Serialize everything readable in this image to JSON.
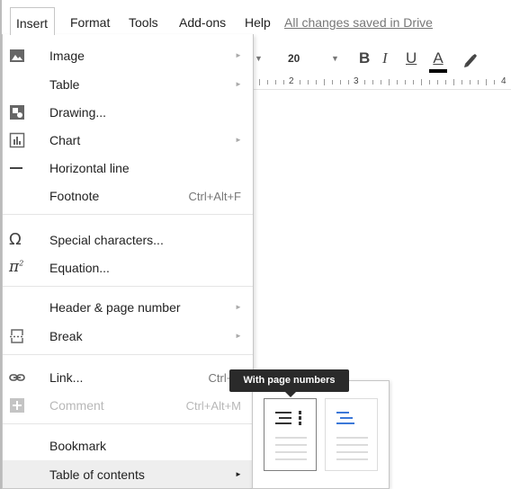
{
  "menubar": {
    "items": [
      "Insert",
      "Format",
      "Tools",
      "Add-ons",
      "Help"
    ],
    "save_status": "All changes saved in Drive"
  },
  "toolbar": {
    "font_size": "20",
    "bold_label": "B",
    "italic_label": "I",
    "underline_label": "U",
    "text_color_label": "A",
    "text_color_bar": "#000000"
  },
  "ruler": {
    "numbers": [
      "2",
      "3",
      "4"
    ]
  },
  "insert_menu": {
    "items": [
      {
        "label": "Image",
        "icon": "image-icon",
        "submenu": true
      },
      {
        "label": "Table",
        "submenu": true
      },
      {
        "label": "Drawing...",
        "icon": "drawing-icon"
      },
      {
        "label": "Chart",
        "icon": "chart-icon",
        "submenu": true
      },
      {
        "label": "Horizontal line",
        "icon": "horizontal-line-icon"
      },
      {
        "label": "Footnote",
        "shortcut": "Ctrl+Alt+F"
      },
      {
        "label": "Special characters...",
        "icon": "omega-icon"
      },
      {
        "label": "Equation...",
        "icon": "pi-icon"
      },
      {
        "label": "Header & page number",
        "submenu": true
      },
      {
        "label": "Break",
        "icon": "page-break-icon",
        "submenu": true
      },
      {
        "label": "Link...",
        "icon": "link-icon",
        "shortcut": "Ctrl+K"
      },
      {
        "label": "Comment",
        "icon": "comment-icon",
        "shortcut": "Ctrl+Alt+M",
        "disabled": true
      },
      {
        "label": "Bookmark"
      },
      {
        "label": "Table of contents",
        "submenu": true,
        "highlighted": true
      }
    ]
  },
  "tooltip": {
    "text": "With page numbers"
  },
  "toc_submenu": {
    "options": [
      "with-page-numbers",
      "with-blue-links"
    ],
    "link_color": "#3c78d8"
  }
}
